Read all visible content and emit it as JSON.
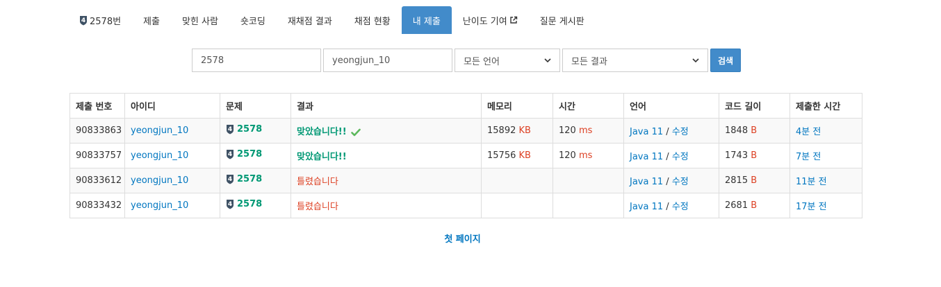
{
  "nav": {
    "tabs": [
      {
        "label": "2578번",
        "tier_badge": "4",
        "active": false
      },
      {
        "label": "제출",
        "active": false
      },
      {
        "label": "맞힌 사람",
        "active": false
      },
      {
        "label": "숏코딩",
        "active": false
      },
      {
        "label": "재채점 결과",
        "active": false
      },
      {
        "label": "채점 현황",
        "active": false
      },
      {
        "label": "내 제출",
        "active": true
      },
      {
        "label": "난이도 기여",
        "active": false,
        "external_icon": "external-link-icon"
      },
      {
        "label": "질문 게시판",
        "active": false
      }
    ]
  },
  "filters": {
    "problem_id": "2578",
    "user_id": "yeongjun_10",
    "language": "모든 언어",
    "result": "모든 결과",
    "search_label": "검색"
  },
  "table": {
    "headers": [
      "제출 번호",
      "아이디",
      "문제",
      "결과",
      "메모리",
      "시간",
      "언어",
      "코드 길이",
      "제출한 시간"
    ],
    "rows": [
      {
        "id": "90833863",
        "user": "yeongjun_10",
        "problem": "2578",
        "tier": "4",
        "result": "맞았습니다!!",
        "status": "ac",
        "check": true,
        "memory": "15892",
        "memory_unit": "KB",
        "time": "120",
        "time_unit": "ms",
        "language": "Java 11",
        "edit": "수정",
        "length": "1848",
        "length_unit": "B",
        "submitted": "4분 전"
      },
      {
        "id": "90833757",
        "user": "yeongjun_10",
        "problem": "2578",
        "tier": "4",
        "result": "맞았습니다!!",
        "status": "ac",
        "check": false,
        "memory": "15756",
        "memory_unit": "KB",
        "time": "120",
        "time_unit": "ms",
        "language": "Java 11",
        "edit": "수정",
        "length": "1743",
        "length_unit": "B",
        "submitted": "7분 전"
      },
      {
        "id": "90833612",
        "user": "yeongjun_10",
        "problem": "2578",
        "tier": "4",
        "result": "틀렸습니다",
        "status": "wa",
        "check": false,
        "memory": "",
        "memory_unit": "",
        "time": "",
        "time_unit": "",
        "language": "Java 11",
        "edit": "수정",
        "length": "2815",
        "length_unit": "B",
        "submitted": "11분 전"
      },
      {
        "id": "90833432",
        "user": "yeongjun_10",
        "problem": "2578",
        "tier": "4",
        "result": "틀렸습니다",
        "status": "wa",
        "check": false,
        "memory": "",
        "memory_unit": "",
        "time": "",
        "time_unit": "",
        "language": "Java 11",
        "edit": "수정",
        "length": "2681",
        "length_unit": "B",
        "submitted": "17분 전"
      }
    ]
  },
  "pagination": {
    "first_page": "첫 페이지"
  },
  "colors": {
    "accent": "#428bca",
    "link": "#0076c0",
    "accepted": "#009874",
    "wrong": "#dd4124",
    "tier_badge": "#3f5265"
  }
}
